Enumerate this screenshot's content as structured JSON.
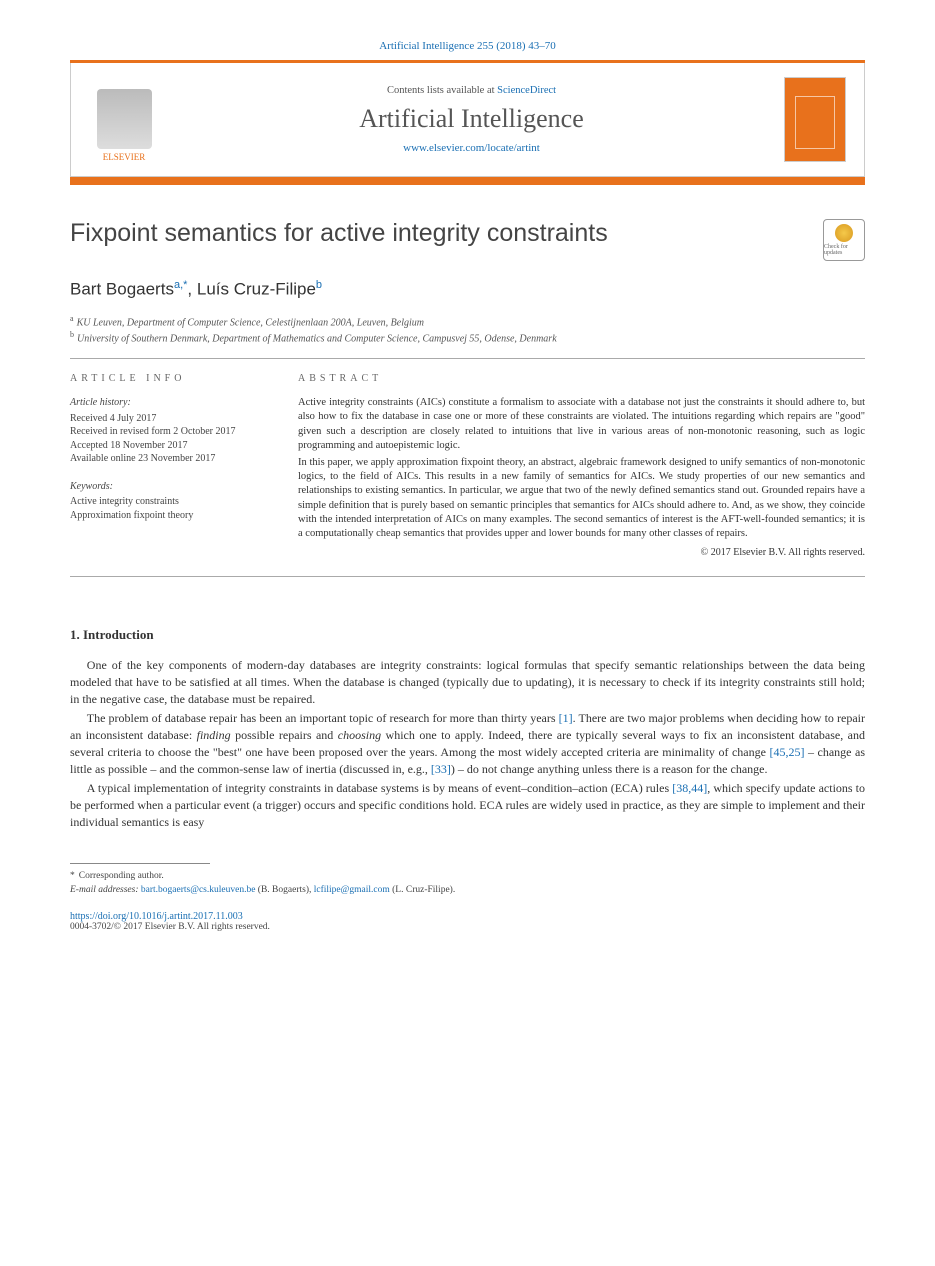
{
  "citation": "Artificial Intelligence 255 (2018) 43–70",
  "header": {
    "contents_prefix": "Contents lists available at ",
    "contents_link": "ScienceDirect",
    "journal_name": "Artificial Intelligence",
    "journal_url": "www.elsevier.com/locate/artint",
    "publisher": "ELSEVIER"
  },
  "title": "Fixpoint semantics for active integrity constraints",
  "check_badge": "Check for updates",
  "authors_html": {
    "a1_name": "Bart Bogaerts",
    "a1_sup": "a,*",
    "sep": ", ",
    "a2_name": "Luís Cruz-Filipe",
    "a2_sup": "b"
  },
  "affiliations": {
    "a": "KU Leuven, Department of Computer Science, Celestijnenlaan 200A, Leuven, Belgium",
    "b": "University of Southern Denmark, Department of Mathematics and Computer Science, Campusvej 55, Odense, Denmark"
  },
  "info_label": "article info",
  "abstract_label": "abstract",
  "history": {
    "hdr": "Article history:",
    "received": "Received 4 July 2017",
    "revised": "Received in revised form 2 October 2017",
    "accepted": "Accepted 18 November 2017",
    "online": "Available online 23 November 2017"
  },
  "keywords": {
    "hdr": "Keywords:",
    "k1": "Active integrity constraints",
    "k2": "Approximation fixpoint theory"
  },
  "abstract": {
    "p1": "Active integrity constraints (AICs) constitute a formalism to associate with a database not just the constraints it should adhere to, but also how to fix the database in case one or more of these constraints are violated. The intuitions regarding which repairs are \"good\" given such a description are closely related to intuitions that live in various areas of non-monotonic reasoning, such as logic programming and autoepistemic logic.",
    "p2": "In this paper, we apply approximation fixpoint theory, an abstract, algebraic framework designed to unify semantics of non-monotonic logics, to the field of AICs. This results in a new family of semantics for AICs. We study properties of our new semantics and relationships to existing semantics. In particular, we argue that two of the newly defined semantics stand out. Grounded repairs have a simple definition that is purely based on semantic principles that semantics for AICs should adhere to. And, as we show, they coincide with the intended interpretation of AICs on many examples. The second semantics of interest is the AFT-well-founded semantics; it is a computationally cheap semantics that provides upper and lower bounds for many other classes of repairs.",
    "copyright": "© 2017 Elsevier B.V. All rights reserved."
  },
  "section1": {
    "heading": "1. Introduction",
    "p1_a": "One of the key components of modern-day databases are integrity constraints: logical formulas that specify semantic relationships between the data being modeled that have to be satisfied at all times. When the database is changed (typically due to updating), it is necessary to check if its integrity constraints still hold; in the negative case, the database must be repaired.",
    "p2_a": "The problem of database repair has been an important topic of research for more than thirty years ",
    "p2_cite1": "[1]",
    "p2_b": ". There are two major problems when deciding how to repair an inconsistent database: ",
    "p2_em1": "finding",
    "p2_c": " possible repairs and ",
    "p2_em2": "choosing",
    "p2_d": " which one to apply. Indeed, there are typically several ways to fix an inconsistent database, and several criteria to choose the \"best\" one have been proposed over the years. Among the most widely accepted criteria are minimality of change ",
    "p2_cite2": "[45,25]",
    "p2_e": " – change as little as possible – and the common-sense law of inertia (discussed in, e.g., ",
    "p2_cite3": "[33]",
    "p2_f": ") – do not change anything unless there is a reason for the change.",
    "p3_a": "A typical implementation of integrity constraints in database systems is by means of event–condition–action (ECA) rules ",
    "p3_cite1": "[38,44]",
    "p3_b": ", which specify update actions to be performed when a particular event (a trigger) occurs and specific conditions hold. ECA rules are widely used in practice, as they are simple to implement and their individual semantics is easy"
  },
  "footnotes": {
    "corr": "Corresponding author.",
    "email_label": "E-mail addresses: ",
    "email1": "bart.bogaerts@cs.kuleuven.be",
    "email1_who": " (B. Bogaerts), ",
    "email2": "lcfilipe@gmail.com",
    "email2_who": " (L. Cruz-Filipe)."
  },
  "doi": "https://doi.org/10.1016/j.artint.2017.11.003",
  "issn": "0004-3702/© 2017 Elsevier B.V. All rights reserved."
}
